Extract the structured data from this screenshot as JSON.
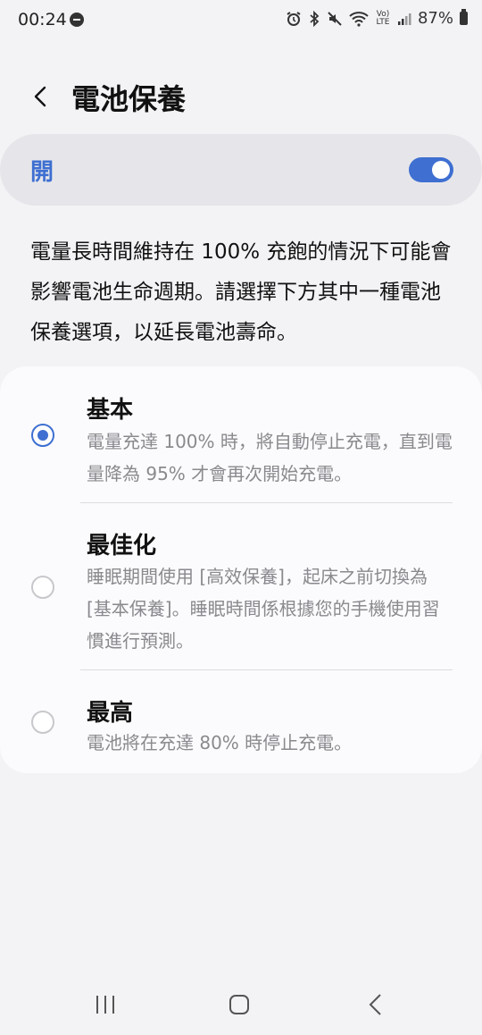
{
  "status_bar": {
    "time": "00:24",
    "battery_percent": "87%",
    "network_label": "Vo) LTE"
  },
  "header": {
    "title": "電池保養"
  },
  "master_toggle": {
    "label": "開",
    "on": true,
    "accent_color": "#3e6fd1"
  },
  "description": "電量長時間維持在 100% 充飽的情況下可能會影響電池生命週期。請選擇下方其中一種電池保養選項，以延長電池壽命。",
  "options": [
    {
      "title": "基本",
      "description": "電量充達 100% 時，將自動停止充電，直到電量降為 95% 才會再次開始充電。",
      "selected": true
    },
    {
      "title": "最佳化",
      "description": "睡眠期間使用 [高效保養]，起床之前切換為 [基本保養]。睡眠時間係根據您的手機使用習慣進行預測。",
      "selected": false
    },
    {
      "title": "最高",
      "description": "電池將在充達 80% 時停止充電。",
      "selected": false
    }
  ],
  "icons": {
    "back": "chevron-left-icon",
    "recent_apps": "recent-apps-icon",
    "home": "home-icon",
    "nav_back": "nav-back-icon"
  }
}
